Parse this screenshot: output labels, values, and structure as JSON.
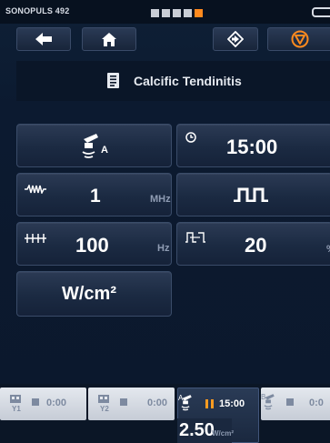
{
  "status_bar": {
    "device_name": "SONOPULS 492",
    "progress_steps": 5,
    "progress_active_step": 5,
    "colors": {
      "accent": "#ff8a1e",
      "inactive": "#c9ced6"
    }
  },
  "toolbar": {
    "buttons": [
      {
        "name": "back-button",
        "icon": "arrow-left-icon"
      },
      {
        "name": "home-button",
        "icon": "home-icon"
      },
      {
        "name": "navigate-button",
        "icon": "diamond-arrow-icon"
      },
      {
        "name": "stop-button",
        "icon": "stop-triangle-icon",
        "color": "#ff8a1e"
      }
    ]
  },
  "header": {
    "icon": "document-icon",
    "title": "Calcific Tendinitis"
  },
  "parameters": {
    "applicator": {
      "icon": "ultrasound-head-icon",
      "label": "A"
    },
    "time": {
      "icon": "clock-icon",
      "value": "15:00"
    },
    "frequency": {
      "icon": "wave-icon",
      "value": "1",
      "unit": "MHz"
    },
    "mode": {
      "icon": "pulse-icon"
    },
    "pulse_frequency": {
      "icon": "pulse-train-icon",
      "value": "100",
      "unit": "Hz"
    },
    "duty_cycle": {
      "icon": "duty-cycle-icon",
      "value": "20",
      "unit": "%"
    },
    "intensity_unit": {
      "unit": "W/cm²"
    }
  },
  "channels": [
    {
      "name": "channel-y1",
      "icon": "electrode-y1-icon",
      "time": "0:00",
      "state": "stopped"
    },
    {
      "name": "channel-y2",
      "icon": "electrode-y2-icon",
      "time": "0:00",
      "state": "stopped"
    },
    {
      "name": "channel-a",
      "icon": "ultrasound-a-icon",
      "label": "A",
      "time": "15:00",
      "state": "paused",
      "value": "2.50",
      "unit": "W/cm²"
    },
    {
      "name": "channel-b",
      "icon": "ultrasound-b-icon",
      "label": "B",
      "time": "0:0",
      "state": "stopped"
    }
  ]
}
